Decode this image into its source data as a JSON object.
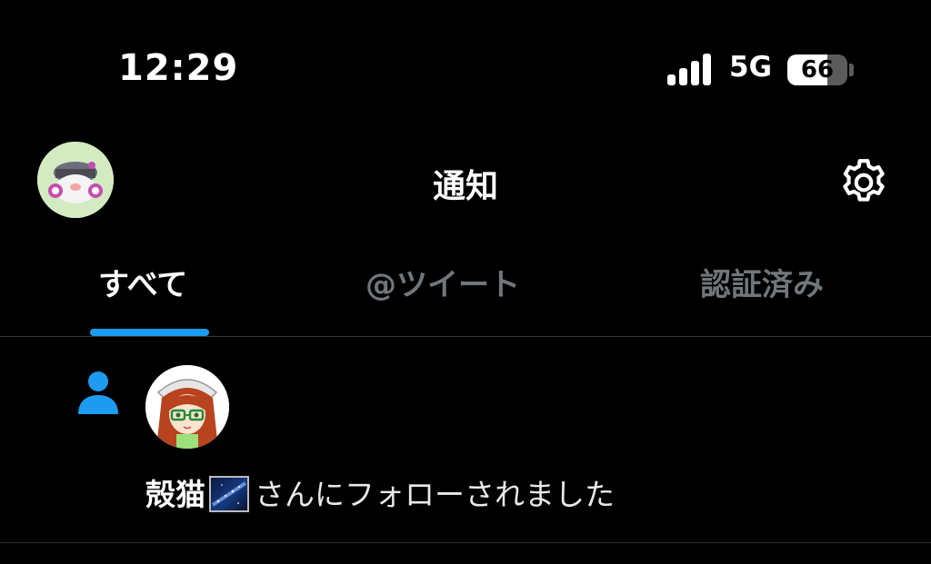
{
  "status_bar": {
    "time": "12:29",
    "network": "5G",
    "signal_bars": 4,
    "battery_percent": 66,
    "icons": [
      "cellular-signal-icon",
      "battery-icon"
    ]
  },
  "header": {
    "title": "通知",
    "icons": [
      "profile-avatar",
      "gear-icon"
    ]
  },
  "tabs": [
    {
      "label": "すべて",
      "active": true
    },
    {
      "label": "@ツイート",
      "active": false
    },
    {
      "label": "認証済み",
      "active": false
    }
  ],
  "notification": {
    "icon": "person-icon",
    "username": "殻猫",
    "emoji_icon": "milky-way-emoji",
    "message": "さんにフォローされました"
  },
  "colors": {
    "background": "#000000",
    "accent": "#1d9bf0",
    "text_primary": "#e7e9ea",
    "text_secondary": "#71767b",
    "divider": "#2f3336"
  }
}
